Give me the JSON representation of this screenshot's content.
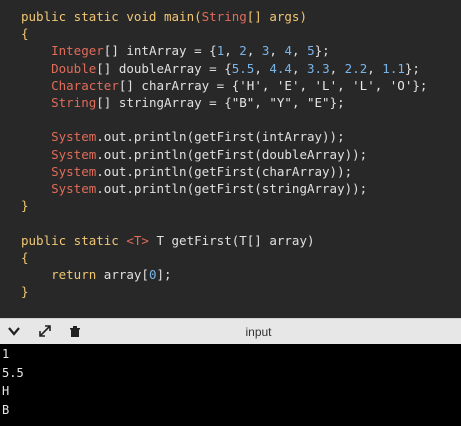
{
  "code": [
    [
      {
        "t": "public static void main(",
        "c": "kw"
      },
      {
        "t": "String",
        "c": "ty"
      },
      {
        "t": "[] args)",
        "c": "kw"
      }
    ],
    [
      {
        "t": "{",
        "c": "kw"
      }
    ],
    [
      {
        "t": "    ",
        "c": ""
      },
      {
        "t": "Integer",
        "c": "ty"
      },
      {
        "t": "[] intArray = {",
        "c": ""
      },
      {
        "t": "1",
        "c": "nu"
      },
      {
        "t": ", ",
        "c": ""
      },
      {
        "t": "2",
        "c": "nu"
      },
      {
        "t": ", ",
        "c": ""
      },
      {
        "t": "3",
        "c": "nu"
      },
      {
        "t": ", ",
        "c": ""
      },
      {
        "t": "4",
        "c": "nu"
      },
      {
        "t": ", ",
        "c": ""
      },
      {
        "t": "5",
        "c": "nu"
      },
      {
        "t": "};",
        "c": ""
      }
    ],
    [
      {
        "t": "    ",
        "c": ""
      },
      {
        "t": "Double",
        "c": "ty"
      },
      {
        "t": "[] doubleArray = {",
        "c": ""
      },
      {
        "t": "5.5",
        "c": "nu"
      },
      {
        "t": ", ",
        "c": ""
      },
      {
        "t": "4.4",
        "c": "nu"
      },
      {
        "t": ", ",
        "c": ""
      },
      {
        "t": "3.3",
        "c": "nu"
      },
      {
        "t": ", ",
        "c": ""
      },
      {
        "t": "2.2",
        "c": "nu"
      },
      {
        "t": ", ",
        "c": ""
      },
      {
        "t": "1.1",
        "c": "nu"
      },
      {
        "t": "};",
        "c": ""
      }
    ],
    [
      {
        "t": "    ",
        "c": ""
      },
      {
        "t": "Character",
        "c": "ty"
      },
      {
        "t": "[] charArray = {",
        "c": ""
      },
      {
        "t": "'H', 'E', 'L', 'L', 'O'",
        "c": "st"
      },
      {
        "t": "};",
        "c": ""
      }
    ],
    [
      {
        "t": "    ",
        "c": ""
      },
      {
        "t": "String",
        "c": "ty"
      },
      {
        "t": "[] stringArray = {",
        "c": ""
      },
      {
        "t": "\"B\", \"Y\", \"E\"",
        "c": "st"
      },
      {
        "t": "};",
        "c": ""
      }
    ],
    [],
    [
      {
        "t": "    ",
        "c": ""
      },
      {
        "t": "System",
        "c": "ty"
      },
      {
        "t": ".out.println(getFirst(intArray));",
        "c": ""
      }
    ],
    [
      {
        "t": "    ",
        "c": ""
      },
      {
        "t": "System",
        "c": "ty"
      },
      {
        "t": ".out.println(getFirst(doubleArray));",
        "c": ""
      }
    ],
    [
      {
        "t": "    ",
        "c": ""
      },
      {
        "t": "System",
        "c": "ty"
      },
      {
        "t": ".out.println(getFirst(charArray));",
        "c": ""
      }
    ],
    [
      {
        "t": "    ",
        "c": ""
      },
      {
        "t": "System",
        "c": "ty"
      },
      {
        "t": ".out.println(getFirst(stringArray));",
        "c": ""
      }
    ],
    [
      {
        "t": "}",
        "c": "kw"
      }
    ],
    [],
    [
      {
        "t": "public static ",
        "c": "kw"
      },
      {
        "t": "<T>",
        "c": "ty"
      },
      {
        "t": " T getFirst(T[] array)",
        "c": ""
      }
    ],
    [
      {
        "t": "{",
        "c": "kw"
      }
    ],
    [
      {
        "t": "    return ",
        "c": "kw"
      },
      {
        "t": "array[",
        "c": ""
      },
      {
        "t": "0",
        "c": "nu"
      },
      {
        "t": "];",
        "c": ""
      }
    ],
    [
      {
        "t": "}",
        "c": "kw"
      }
    ]
  ],
  "panel": {
    "title": "input",
    "icons": [
      "chevron-down-icon",
      "expand-icon",
      "clear-console-icon"
    ]
  },
  "output": [
    "1",
    "5.5",
    "H",
    "B"
  ],
  "colors": {
    "editor_bg": "#282828",
    "keyword": "#f0c674",
    "type": "#e06c5a",
    "number": "#79b4e8",
    "console_bg": "#000000"
  }
}
